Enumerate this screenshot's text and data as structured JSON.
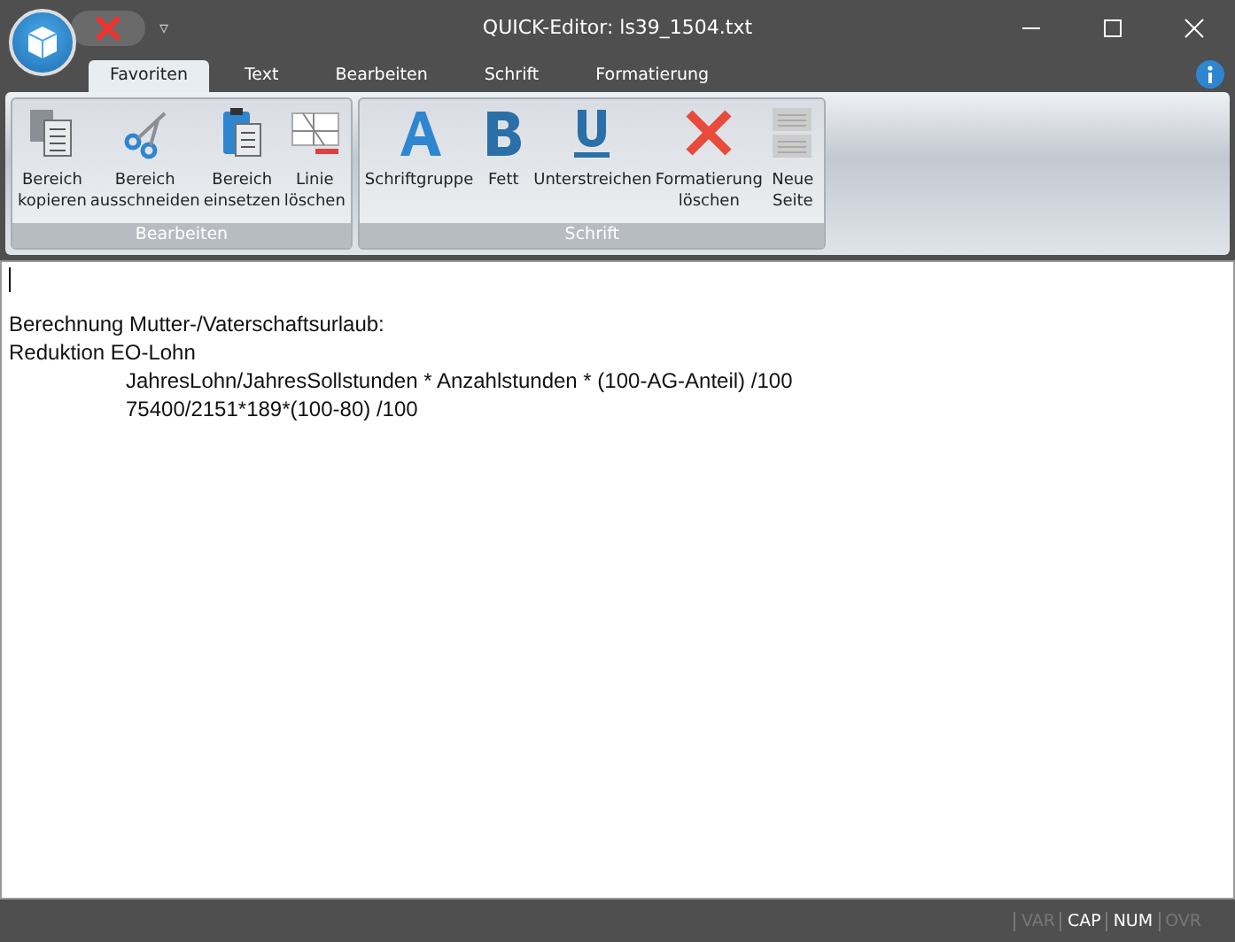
{
  "window": {
    "title": "QUICK-Editor: ls39_1504.txt"
  },
  "quick_access": {
    "menu_glyph": "▿"
  },
  "tabs": [
    {
      "label": "Favoriten",
      "selected": true
    },
    {
      "label": "Text",
      "selected": false
    },
    {
      "label": "Bearbeiten",
      "selected": false
    },
    {
      "label": "Schrift",
      "selected": false
    },
    {
      "label": "Formatierung",
      "selected": false
    }
  ],
  "ribbon_groups": [
    {
      "title": "Bearbeiten",
      "buttons": [
        {
          "kind": "copy",
          "label": "Bereich\nkopieren"
        },
        {
          "kind": "cut",
          "label": "Bereich\nausschneiden"
        },
        {
          "kind": "paste",
          "label": "Bereich\neinsetzen"
        },
        {
          "kind": "delete-line",
          "label": "Linie\nlöschen"
        }
      ]
    },
    {
      "title": "Schrift",
      "buttons": [
        {
          "kind": "font",
          "label": "Schriftgruppe"
        },
        {
          "kind": "bold",
          "label": "Fett"
        },
        {
          "kind": "underline",
          "label": "Unterstreichen"
        },
        {
          "kind": "clear",
          "label": "Formatierung\nlöschen"
        },
        {
          "kind": "page",
          "label": "Neue\nSeite"
        }
      ]
    }
  ],
  "editor": {
    "lines": [
      {
        "text": "Berechnung Mutter-/Vaterschaftsurlaub:"
      },
      {
        "text": "Reduktion EO-Lohn",
        "children": [
          {
            "text": "JahresLohn/JahresSollstunden * Anzahlstunden * (100-AG-Anteil) /100"
          },
          {
            "text": "75400/2151*189*(100-80) /100"
          }
        ]
      }
    ]
  },
  "status_bar": {
    "indicators": [
      {
        "label": "VAR",
        "on": false
      },
      {
        "label": "CAP",
        "on": true
      },
      {
        "label": "NUM",
        "on": true
      },
      {
        "label": "OVR",
        "on": false
      }
    ]
  }
}
